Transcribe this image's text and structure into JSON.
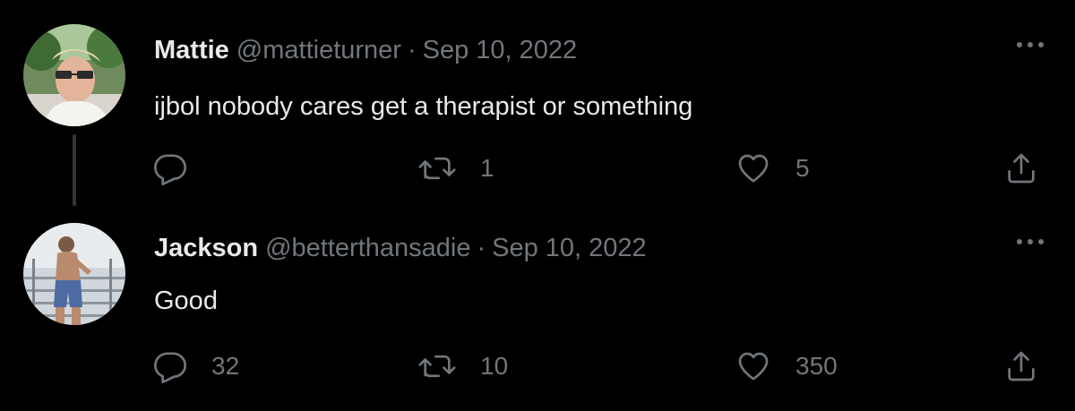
{
  "tweets": [
    {
      "name": "Mattie",
      "handle": "@mattieturner",
      "separator": "·",
      "date": "Sep 10, 2022",
      "text": "ijbol nobody cares get a therapist or something",
      "replies": "",
      "retweets": "1",
      "likes": "5"
    },
    {
      "name": "Jackson",
      "handle": "@betterthansadie",
      "separator": "·",
      "date": "Sep 10, 2022",
      "text": "Good",
      "replies": "32",
      "retweets": "10",
      "likes": "350"
    }
  ],
  "icons": {
    "reply": "reply-icon",
    "retweet": "retweet-icon",
    "like": "heart-icon",
    "share": "share-icon",
    "more": "more-icon"
  },
  "colors": {
    "background": "#000000",
    "primary_text": "#e7e9ea",
    "secondary_text": "#71767b",
    "thread_line": "#333639"
  }
}
